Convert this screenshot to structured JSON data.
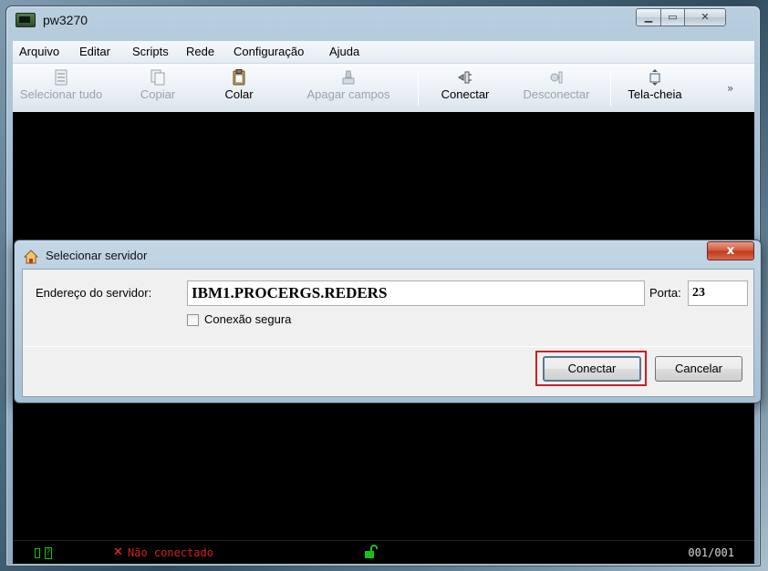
{
  "window": {
    "title": "pw3270"
  },
  "menu": [
    "Arquivo",
    "Editar",
    "Scripts",
    "Rede",
    "Configuração",
    "Ajuda"
  ],
  "toolbar": {
    "items": [
      {
        "label": "Selecionar tudo",
        "enabled": false
      },
      {
        "label": "Copiar",
        "enabled": false
      },
      {
        "label": "Colar",
        "enabled": true
      },
      {
        "label": "Apagar campos",
        "enabled": false
      },
      {
        "label": "Conectar",
        "enabled": true
      },
      {
        "label": "Desconectar",
        "enabled": false
      },
      {
        "label": "Tela-cheia",
        "enabled": true
      }
    ],
    "more": "»"
  },
  "status": {
    "connection": "Não conectado",
    "cursor": "001/001"
  },
  "dialog": {
    "title": "Selecionar servidor",
    "close": "x",
    "server_label": "Endereço do servidor:",
    "server_value": "IBM1.PROCERGS.REDERS",
    "port_label": "Porta:",
    "port_value": "23",
    "secure_label": "Conexão segura",
    "secure_checked": false,
    "connect_label": "Conectar",
    "cancel_label": "Cancelar"
  }
}
